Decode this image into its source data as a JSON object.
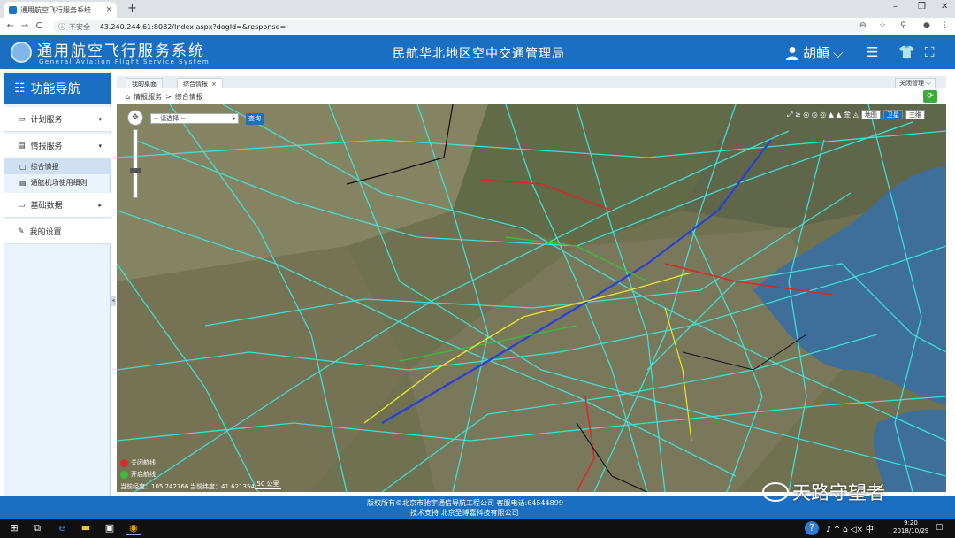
{
  "browser": {
    "tab_title": "通用航空飞行服务系统",
    "tab_close": "×",
    "new_tab": "+",
    "insecure_label": "不安全",
    "url": "43.240.244.61:8082/Index.aspx?dogId=&response=",
    "back": "←",
    "forward": "→",
    "reload": "C",
    "zoom_icon": "⊖",
    "star_icon": "☆",
    "ext_icon": "⚲",
    "account_icon": "●",
    "menu_icon": "⋮",
    "minimize": "–",
    "maximize": "❐",
    "close": "✕"
  },
  "header": {
    "title": "通用航空飞行服务系统",
    "subtitle": "General Aviation Flight Service System",
    "org": "民航华北地区空中交通管理局",
    "user_icon": "user-icon",
    "user_name": "胡頔",
    "user_caret": "⌵",
    "menu_glyph": "☰",
    "shirt_glyph": "👕",
    "fullscreen_glyph": "⛶",
    "brand_color": "#1b6fc2"
  },
  "sidebar": {
    "title": "功能导航",
    "title_icon": "☷",
    "items": [
      {
        "label": "计划服务",
        "icon": "▭",
        "caret": "▾"
      },
      {
        "label": "情报服务",
        "icon": "▤",
        "caret": "▾",
        "children": [
          {
            "label": "综合情报",
            "icon": "▢"
          },
          {
            "label": "通航机场使用细则",
            "icon": "▤"
          }
        ]
      },
      {
        "label": "基础数据",
        "icon": "▭",
        "caret": "▸"
      },
      {
        "label": "我的设置",
        "icon": "✎"
      }
    ],
    "collapse_glyph": "◂"
  },
  "tabs": {
    "items": [
      {
        "label": "我的桌面"
      },
      {
        "label": "综合情报",
        "close": "×"
      }
    ],
    "close_all": "关闭管理 ⌵"
  },
  "breadcrumb": {
    "home_icon": "⌂",
    "path": [
      "情报服务",
      "综合情报"
    ],
    "sep": ">",
    "refresh": "⟳"
  },
  "map": {
    "pan_glyph": "✥",
    "select_placeholder": "-- 请选择 --",
    "select_caret": "▾",
    "query_button": "查询",
    "tool_glyphs": "⤢ ≥ ◎ ◎ ◎ ▲ ▲ 金 ◬",
    "layer_buttons": [
      "地图",
      "卫星",
      "三维"
    ],
    "active_layer": "卫星",
    "legend": [
      {
        "label": "关闭航线",
        "color": "#d62a2a"
      },
      {
        "label": "开启航线",
        "color": "#3dbb3d"
      }
    ],
    "lng_label": "当前经度：105.742766",
    "lat_label": "当前纬度：41.621354",
    "scale_label": "50 公里",
    "route_colors": {
      "airway": "#3ee8e0",
      "primary": "#2a3fd8",
      "closed": "#d62a2a",
      "open": "#3dbb3d",
      "special": "#e6e630",
      "border": "#111111"
    }
  },
  "footer": {
    "line1": "版权所有©北京市驰宇通信导航工程公司    客服电话:64544899",
    "line2": "技术支持   北京圣博嘉科技有限公司"
  },
  "watermark": "天路守望者",
  "taskbar": {
    "start_glyph": "⊞",
    "taskview_glyph": "⧉",
    "edge_glyph": "e",
    "folder_glyph": "▬",
    "store_glyph": "▣",
    "chrome_glyph": "◉",
    "help_glyph": "?",
    "tray_glyphs": "♪  ^ ⌂ ◁× 中",
    "notif_glyph": "▢",
    "time": "9:20",
    "date": "2018/10/29"
  }
}
